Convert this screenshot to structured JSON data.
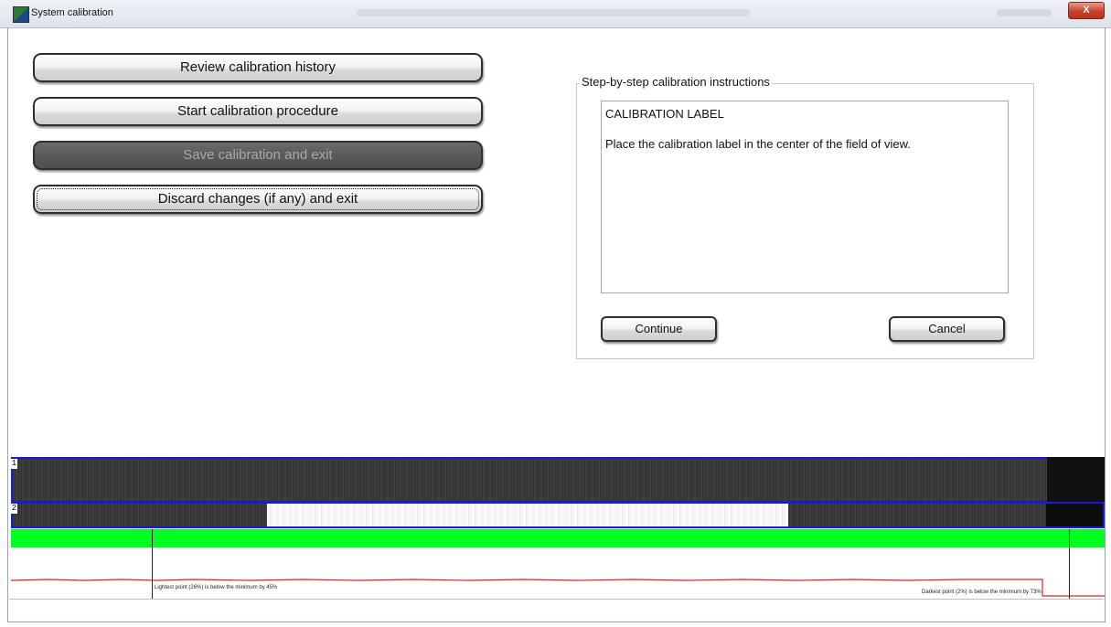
{
  "window": {
    "title": "System calibration",
    "close_label": "X"
  },
  "actions": {
    "review_history": "Review calibration history",
    "start_procedure": "Start calibration procedure",
    "save_and_exit": "Save calibration and exit",
    "discard_and_exit": "Discard changes (if any) and exit"
  },
  "instructions": {
    "legend": "Step-by-step calibration instructions",
    "step_title": "CALIBRATION LABEL",
    "step_text": "Place the calibration label in the center of the field of view.",
    "continue_label": "Continue",
    "cancel_label": "Cancel"
  },
  "camera": {
    "strip1_label": "1",
    "strip2_label": "2"
  },
  "graph": {
    "lightest_msg": "Lightest point (26%) is below the minimum by 45%",
    "darkest_msg": "Darkest point (2%) is below the minimum by 73%",
    "line_color": "#e02020",
    "indicator_color": "#00ff1e"
  },
  "colors": {
    "strip_border": "#1a1ad6",
    "disabled_button": "#5a5a5a"
  }
}
